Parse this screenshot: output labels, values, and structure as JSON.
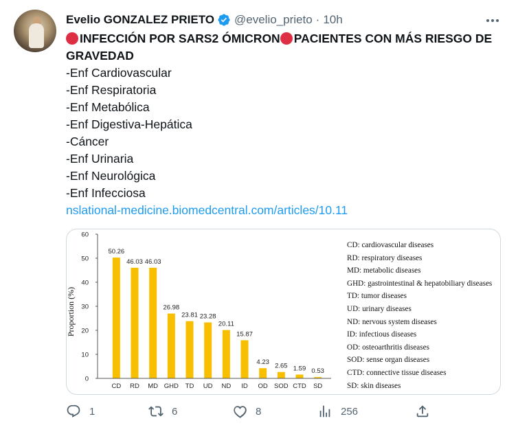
{
  "tweet": {
    "author_name": "Evelio GONZALEZ PRIETO",
    "handle": "@evelio_prieto",
    "separator": "·",
    "time": "10h",
    "title_part1": "INFECCIÓN POR SARS2 ÓMICRON",
    "title_part2": "PACIENTES CON MÁS RIESGO DE GRAVEDAD",
    "list": [
      "-Enf Cardiovascular",
      "-Enf Respiratoria",
      "-Enf Metabólica",
      "-Enf Digestiva-Hepática",
      "-Cáncer",
      "-Enf Urinaria",
      "-Enf Neurológica",
      "-Enf Infecciosa"
    ],
    "link": "nslational-medicine.biomedcentral.com/articles/10.11",
    "icons": {
      "verified": "verified-badge-icon",
      "more": "more-options-icon",
      "red_circle": "red-circle-emoji-icon"
    }
  },
  "actions": {
    "reply": {
      "icon": "reply-icon",
      "count": "1"
    },
    "retweet": {
      "icon": "retweet-icon",
      "count": "6"
    },
    "like": {
      "icon": "heart-icon",
      "count": "8"
    },
    "views": {
      "icon": "views-icon",
      "count": "256"
    },
    "share": {
      "icon": "share-icon"
    }
  },
  "colors": {
    "accent": "#1d9bf0",
    "bar": "#f7bf00",
    "muted": "#536471",
    "red": "#dd2e44"
  },
  "chart_data": {
    "type": "bar",
    "categories": [
      "CD",
      "RD",
      "MD",
      "GHD",
      "TD",
      "UD",
      "ND",
      "ID",
      "OD",
      "SOD",
      "CTD",
      "SD"
    ],
    "values": [
      50.26,
      46.03,
      46.03,
      26.98,
      23.81,
      23.28,
      20.11,
      15.87,
      4.23,
      2.65,
      1.59,
      0.53
    ],
    "value_labels": [
      "50.26",
      "46.03",
      "46.03",
      "26.98",
      "23.81",
      "23.28",
      "20.11",
      "15.87",
      "4.23",
      "2.65",
      "1.59",
      "0.53"
    ],
    "ylabel": "Proportion (%)",
    "ylim": [
      0,
      60
    ],
    "yticks": [
      "0",
      "10",
      "20",
      "30",
      "40",
      "50",
      "60"
    ],
    "legend_position": "right",
    "legend": [
      "CD: cardiovascular diseases",
      "RD: respiratory diseases",
      "MD: metabolic diseases",
      "GHD: gastrointestinal & hepatobiliary diseases",
      "TD: tumor diseases",
      "UD: urinary diseases",
      "ND: nervous system diseases",
      "ID: infectious diseases",
      "OD: osteoarthritis diseases",
      "SOD: sense organ diseases",
      "CTD: connective tissue diseases",
      "SD: skin diseases"
    ]
  }
}
